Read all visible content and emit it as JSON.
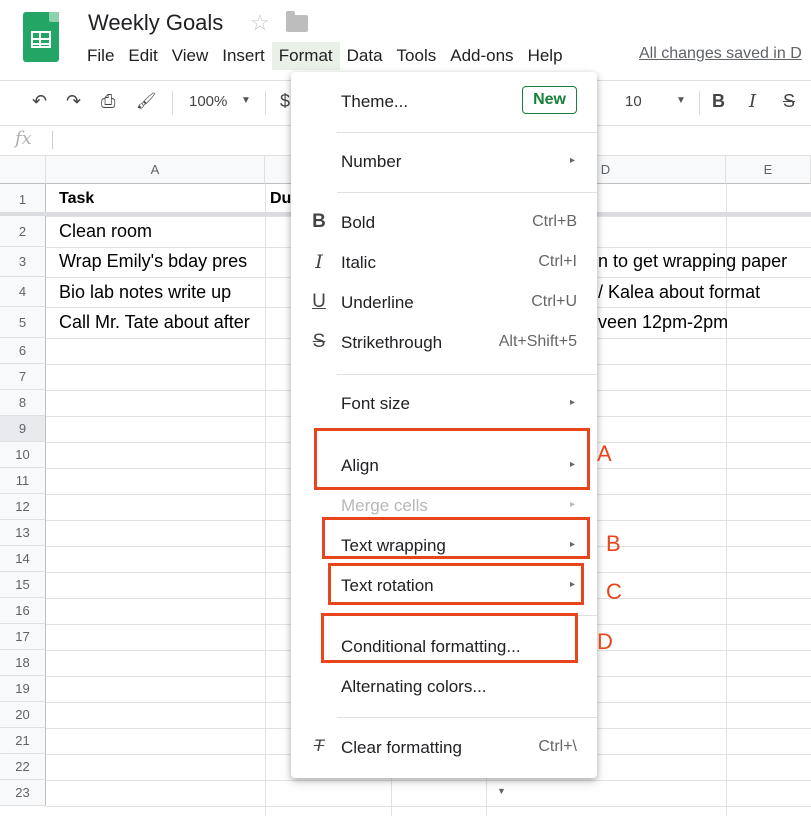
{
  "app": {
    "title": "Weekly Goals",
    "star_glyph": "☆",
    "saved_status": "All changes saved in D"
  },
  "menubar": [
    "File",
    "Edit",
    "View",
    "Insert",
    "Format",
    "Data",
    "Tools",
    "Add-ons",
    "Help"
  ],
  "toolbar": {
    "undo": "↶",
    "redo": "↷",
    "print": "⎙",
    "paint": "🖌",
    "zoom": "100%",
    "currency": "$",
    "font_size": "10",
    "bold": "B",
    "italic": "I",
    "strike": "S"
  },
  "formula_bar": {
    "fx": "fx"
  },
  "grid": {
    "columns": [
      "A",
      "D",
      "E"
    ],
    "rows": [
      "1",
      "2",
      "3",
      "4",
      "5",
      "6",
      "7",
      "8",
      "9",
      "10",
      "11",
      "12",
      "13",
      "14",
      "15",
      "16",
      "17",
      "18",
      "19",
      "20",
      "21",
      "22",
      "23"
    ],
    "cells": {
      "a1": "Task",
      "b1": "Du",
      "a2": "Clean room",
      "a3": "Wrap Emily's bday pres",
      "a4": "Bio lab notes write up",
      "a5": "Call Mr. Tate about after",
      "d3": "n to get wrapping paper",
      "d4": "/ Kalea about format",
      "d5": "veen 12pm-2pm"
    }
  },
  "format_menu": {
    "theme": "Theme...",
    "new_badge": "New",
    "number": "Number",
    "bold": "Bold",
    "bold_sc": "Ctrl+B",
    "bold_icon": "B",
    "italic": "Italic",
    "italic_sc": "Ctrl+I",
    "italic_icon": "I",
    "underline": "Underline",
    "underline_sc": "Ctrl+U",
    "underline_icon": "U",
    "strikethrough": "Strikethrough",
    "strikethrough_sc": "Alt+Shift+5",
    "strike_icon": "S",
    "font_size": "Font size",
    "align": "Align",
    "merge_cells": "Merge cells",
    "text_wrapping": "Text wrapping",
    "text_rotation": "Text rotation",
    "conditional_formatting": "Conditional formatting...",
    "alternating_colors": "Alternating colors...",
    "clear_formatting": "Clear formatting",
    "clear_sc": "Ctrl+\\",
    "arrow": "▸"
  },
  "annotations": {
    "a": "A",
    "b": "B",
    "c": "C",
    "d": "D"
  },
  "colors": {
    "accent": "#188038",
    "highlight": "#e8451c",
    "logo": "#23a566"
  }
}
